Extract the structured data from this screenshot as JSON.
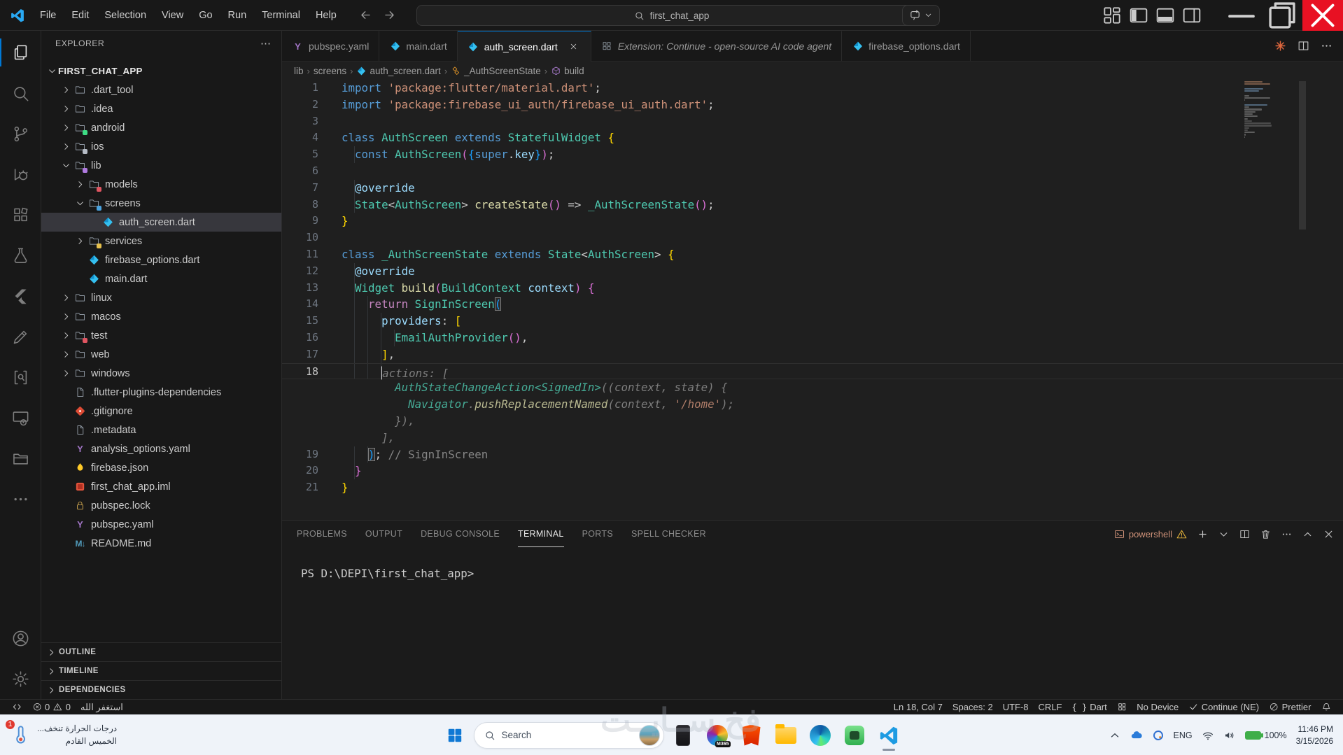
{
  "window": {
    "search_value": "first_chat_app"
  },
  "menus": [
    "File",
    "Edit",
    "Selection",
    "View",
    "Go",
    "Run",
    "Terminal",
    "Help"
  ],
  "titlebar": {
    "layout_icons": [
      "layout-grid",
      "layout-sidebar-left",
      "layout-panel",
      "layout-sidebar-right"
    ],
    "window_controls": [
      "minimize",
      "restore",
      "close"
    ]
  },
  "activity": {
    "top": [
      "files",
      "search",
      "source-control",
      "run-debug",
      "extensions",
      "testing",
      "flutter",
      "edit-pencil",
      "search-editor",
      "live-preview",
      "library",
      "more"
    ],
    "bottom": [
      "account",
      "settings"
    ],
    "active": "files"
  },
  "sidebar": {
    "title": "EXPLORER",
    "root": "FIRST_CHAT_APP",
    "tree": [
      {
        "label": ".dart_tool",
        "depth": 1,
        "icon": "folder",
        "chev": "closed"
      },
      {
        "label": ".idea",
        "depth": 1,
        "icon": "folder",
        "chev": "closed"
      },
      {
        "label": "android",
        "depth": 1,
        "icon": "folder",
        "chev": "closed",
        "badge": "#3ddc84"
      },
      {
        "label": "ios",
        "depth": 1,
        "icon": "folder",
        "chev": "closed",
        "badge": "#b6bcc6"
      },
      {
        "label": "lib",
        "depth": 1,
        "icon": "folder",
        "chev": "open",
        "badge": "#b07ae0"
      },
      {
        "label": "models",
        "depth": 2,
        "icon": "folder",
        "chev": "closed",
        "badge": "#e05561"
      },
      {
        "label": "screens",
        "depth": 2,
        "icon": "folder",
        "chev": "open",
        "badge": "#4aa3e0"
      },
      {
        "label": "auth_screen.dart",
        "depth": 3,
        "icon": "dart",
        "selected": true
      },
      {
        "label": "services",
        "depth": 2,
        "icon": "folder",
        "chev": "closed",
        "badge": "#e6c04c"
      },
      {
        "label": "firebase_options.dart",
        "depth": 2,
        "icon": "dart"
      },
      {
        "label": "main.dart",
        "depth": 2,
        "icon": "dart"
      },
      {
        "label": "linux",
        "depth": 1,
        "icon": "folder",
        "chev": "closed"
      },
      {
        "label": "macos",
        "depth": 1,
        "icon": "folder",
        "chev": "closed"
      },
      {
        "label": "test",
        "depth": 1,
        "icon": "folder",
        "chev": "closed",
        "badge": "#e05561"
      },
      {
        "label": "web",
        "depth": 1,
        "icon": "folder",
        "chev": "closed"
      },
      {
        "label": "windows",
        "depth": 1,
        "icon": "folder",
        "chev": "closed"
      },
      {
        "label": ".flutter-plugins-dependencies",
        "depth": 1,
        "icon": "file"
      },
      {
        "label": ".gitignore",
        "depth": 1,
        "icon": "git"
      },
      {
        "label": ".metadata",
        "depth": 1,
        "icon": "file"
      },
      {
        "label": "analysis_options.yaml",
        "depth": 1,
        "icon": "yaml"
      },
      {
        "label": "firebase.json",
        "depth": 1,
        "icon": "flame"
      },
      {
        "label": "first_chat_app.iml",
        "depth": 1,
        "icon": "iml"
      },
      {
        "label": "pubspec.lock",
        "depth": 1,
        "icon": "lock"
      },
      {
        "label": "pubspec.yaml",
        "depth": 1,
        "icon": "yaml"
      },
      {
        "label": "README.md",
        "depth": 1,
        "icon": "md"
      }
    ],
    "sections": [
      "OUTLINE",
      "TIMELINE",
      "DEPENDENCIES"
    ]
  },
  "tabs": [
    {
      "label": "pubspec.yaml",
      "icon": "yaml"
    },
    {
      "label": "main.dart",
      "icon": "dart"
    },
    {
      "label": "auth_screen.dart",
      "icon": "dart",
      "active": true,
      "close": true
    },
    {
      "label": "Extension: Continue - open-source AI code agent",
      "icon": "extension",
      "italic": true
    },
    {
      "label": "firebase_options.dart",
      "icon": "dart"
    }
  ],
  "editor_actions": [
    "flutter-burst",
    "split-editor",
    "more"
  ],
  "breadcrumbs": [
    {
      "label": "lib"
    },
    {
      "label": "screens"
    },
    {
      "label": "auth_screen.dart",
      "icon": "dart"
    },
    {
      "label": "_AuthScreenState",
      "icon": "symbol-class"
    },
    {
      "label": "build",
      "icon": "symbol-method"
    }
  ],
  "code": {
    "lines": [
      {
        "num": "1",
        "indent": 0,
        "tokens": [
          [
            "import",
            "kw"
          ],
          [
            " ",
            "pln"
          ],
          [
            "'package:flutter/material.dart'",
            "str"
          ],
          [
            ";",
            "pln"
          ]
        ]
      },
      {
        "num": "2",
        "indent": 0,
        "tokens": [
          [
            "import",
            "kw"
          ],
          [
            " ",
            "pln"
          ],
          [
            "'package:firebase_ui_auth/firebase_ui_auth.dart'",
            "str"
          ],
          [
            ";",
            "pln"
          ]
        ]
      },
      {
        "num": "3",
        "indent": 0,
        "tokens": []
      },
      {
        "num": "4",
        "indent": 0,
        "tokens": [
          [
            "class",
            "kw"
          ],
          [
            " ",
            "pln"
          ],
          [
            "AuthScreen",
            "type"
          ],
          [
            " ",
            "pln"
          ],
          [
            "extends",
            "kw"
          ],
          [
            " ",
            "pln"
          ],
          [
            "StatefulWidget",
            "type"
          ],
          [
            " ",
            "pln"
          ],
          [
            "{",
            "b1"
          ]
        ]
      },
      {
        "num": "5",
        "indent": 2,
        "tokens": [
          [
            "  ",
            "pln"
          ],
          [
            "const",
            "kw"
          ],
          [
            " ",
            "pln"
          ],
          [
            "AuthScreen",
            "type"
          ],
          [
            "(",
            "b2"
          ],
          [
            "{",
            "b3"
          ],
          [
            "super",
            "kw"
          ],
          [
            ".",
            "pln"
          ],
          [
            "key",
            "var"
          ],
          [
            "}",
            "b3"
          ],
          [
            ")",
            "b2"
          ],
          [
            ";",
            "pln"
          ]
        ]
      },
      {
        "num": "6",
        "indent": 0,
        "tokens": []
      },
      {
        "num": "7",
        "indent": 2,
        "tokens": [
          [
            "  ",
            "pln"
          ],
          [
            "@override",
            "var"
          ]
        ]
      },
      {
        "num": "8",
        "indent": 2,
        "tokens": [
          [
            "  ",
            "pln"
          ],
          [
            "State",
            "type"
          ],
          [
            "<",
            "pln"
          ],
          [
            "AuthScreen",
            "type"
          ],
          [
            ">",
            "pln"
          ],
          [
            " ",
            "pln"
          ],
          [
            "createState",
            "fn"
          ],
          [
            "(",
            "b2"
          ],
          [
            ")",
            "b2"
          ],
          [
            " => ",
            "pln"
          ],
          [
            "_AuthScreenState",
            "type"
          ],
          [
            "(",
            "b2"
          ],
          [
            ")",
            "b2"
          ],
          [
            ";",
            "pln"
          ]
        ]
      },
      {
        "num": "9",
        "indent": 0,
        "tokens": [
          [
            "}",
            "b1"
          ]
        ]
      },
      {
        "num": "10",
        "indent": 0,
        "tokens": []
      },
      {
        "num": "11",
        "indent": 0,
        "tokens": [
          [
            "class",
            "kw"
          ],
          [
            " ",
            "pln"
          ],
          [
            "_AuthScreenState",
            "type"
          ],
          [
            " ",
            "pln"
          ],
          [
            "extends",
            "kw"
          ],
          [
            " ",
            "pln"
          ],
          [
            "State",
            "type"
          ],
          [
            "<",
            "pln"
          ],
          [
            "AuthScreen",
            "type"
          ],
          [
            ">",
            "pln"
          ],
          [
            " ",
            "pln"
          ],
          [
            "{",
            "b1"
          ]
        ]
      },
      {
        "num": "12",
        "indent": 2,
        "tokens": [
          [
            "  ",
            "pln"
          ],
          [
            "@override",
            "var"
          ]
        ]
      },
      {
        "num": "13",
        "indent": 2,
        "tokens": [
          [
            "  ",
            "pln"
          ],
          [
            "Widget",
            "type"
          ],
          [
            " ",
            "pln"
          ],
          [
            "build",
            "fn"
          ],
          [
            "(",
            "b2"
          ],
          [
            "BuildContext",
            "type"
          ],
          [
            " ",
            "pln"
          ],
          [
            "context",
            "var"
          ],
          [
            ")",
            "b2"
          ],
          [
            " ",
            "pln"
          ],
          [
            "{",
            "b2"
          ]
        ]
      },
      {
        "num": "14",
        "indent": 4,
        "tokens": [
          [
            "    ",
            "pln"
          ],
          [
            "return",
            "ctrl"
          ],
          [
            " ",
            "pln"
          ],
          [
            "SignInScreen",
            "type"
          ],
          [
            "(",
            "b3 match"
          ]
        ]
      },
      {
        "num": "15",
        "indent": 6,
        "tokens": [
          [
            "      ",
            "pln"
          ],
          [
            "providers",
            "var"
          ],
          [
            ":",
            "pln"
          ],
          [
            " ",
            "pln"
          ],
          [
            "[",
            "b1"
          ]
        ]
      },
      {
        "num": "16",
        "indent": 8,
        "tokens": [
          [
            "        ",
            "pln"
          ],
          [
            "EmailAuthProvider",
            "type"
          ],
          [
            "(",
            "b2"
          ],
          [
            ")",
            "b2"
          ],
          [
            ",",
            "pln"
          ]
        ]
      },
      {
        "num": "17",
        "indent": 6,
        "tokens": [
          [
            "      ",
            "pln"
          ],
          [
            "]",
            "b1"
          ],
          [
            ",",
            "pln"
          ]
        ]
      },
      {
        "num": "18",
        "indent": 6,
        "current": true,
        "tokens": [
          [
            "      ",
            "pln"
          ],
          [
            "",
            "cursor"
          ],
          [
            "actions: [",
            "ghost"
          ]
        ]
      },
      {
        "num": "",
        "indent": 0,
        "tokens": [
          [
            "        ",
            "pln"
          ],
          [
            "AuthStateChangeAction<SignedIn>",
            "gt"
          ],
          [
            "((context, state) {",
            "ghost"
          ]
        ]
      },
      {
        "num": "",
        "indent": 0,
        "tokens": [
          [
            "          ",
            "pln"
          ],
          [
            "Navigator",
            "gt"
          ],
          [
            ".",
            "ghost"
          ],
          [
            "pushReplacementNamed",
            "gf"
          ],
          [
            "(context, ",
            "ghost"
          ],
          [
            "'/home'",
            "gs"
          ],
          [
            ");",
            "ghost"
          ]
        ]
      },
      {
        "num": "",
        "indent": 0,
        "tokens": [
          [
            "        }),",
            "ghost"
          ]
        ]
      },
      {
        "num": "",
        "indent": 0,
        "tokens": [
          [
            "      ],",
            "ghost"
          ]
        ]
      },
      {
        "num": "19",
        "indent": 4,
        "tokens": [
          [
            "    ",
            "pln"
          ],
          [
            ")",
            "b3 match"
          ],
          [
            ";",
            "pln"
          ],
          [
            " ",
            "pln"
          ],
          [
            "// SignInScreen",
            "cmt"
          ]
        ]
      },
      {
        "num": "20",
        "indent": 2,
        "tokens": [
          [
            "  ",
            "pln"
          ],
          [
            "}",
            "b2"
          ]
        ]
      },
      {
        "num": "21",
        "indent": 0,
        "tokens": [
          [
            "}",
            "b1"
          ]
        ]
      }
    ]
  },
  "panel": {
    "tabs": [
      "PROBLEMS",
      "OUTPUT",
      "DEBUG CONSOLE",
      "TERMINAL",
      "PORTS",
      "SPELL CHECKER"
    ],
    "active": "TERMINAL",
    "shell_label": "powershell",
    "actions": [
      "plus",
      "chevron-down",
      "split-editor",
      "trash",
      "more",
      "chevron-up",
      "close"
    ],
    "prompt": "PS D:\\DEPI\\first_chat_app>"
  },
  "status": {
    "left": [
      {
        "icon": "remote",
        "name": "remote"
      },
      {
        "icon": "error",
        "label": "0",
        "icon2": "warning",
        "label2": "0",
        "name": "problems"
      },
      {
        "label": "استغفر الله",
        "name": "custom-text"
      }
    ],
    "right": [
      {
        "label": "Ln 18, Col 7",
        "name": "cursor-position"
      },
      {
        "label": "Spaces: 2",
        "name": "indentation"
      },
      {
        "label": "UTF-8",
        "name": "encoding"
      },
      {
        "label": "CRLF",
        "name": "eol"
      },
      {
        "icon": "braces",
        "label": "Dart",
        "name": "language-mode"
      },
      {
        "icon": "grid",
        "name": "layout"
      },
      {
        "label": "No Device",
        "name": "flutter-device"
      },
      {
        "icon": "check",
        "label": "Continue (NE)",
        "name": "continue-extension"
      },
      {
        "icon": "slash",
        "label": "Prettier",
        "name": "prettier"
      },
      {
        "icon": "bell",
        "name": "notifications"
      }
    ]
  },
  "taskbar": {
    "widget": {
      "badge": "1",
      "line1": "درجات الحرارة تنخف...",
      "line2": "الخميس القادم"
    },
    "search_label": "Search",
    "apps": [
      "dark-app",
      "m365-copilot",
      "brave",
      "file-explorer",
      "edge",
      "android-app",
      "vscode"
    ],
    "active_app": "vscode",
    "m365_badge": "M365",
    "tray": {
      "lang": "ENG",
      "battery": "100%",
      "time": "11:46 PM",
      "date": "3/15/2026"
    }
  },
  "watermark": "فخ ســايــت"
}
